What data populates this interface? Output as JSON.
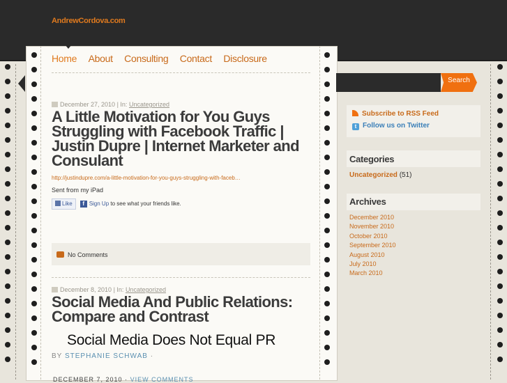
{
  "site": {
    "title": "AndrewCordova.com"
  },
  "nav": {
    "items": [
      {
        "label": "Home",
        "active": true
      },
      {
        "label": "About"
      },
      {
        "label": "Consulting"
      },
      {
        "label": "Contact"
      },
      {
        "label": "Disclosure"
      }
    ]
  },
  "posts": [
    {
      "date": "December 27, 2010",
      "in_label": "| In:",
      "category": "Uncategorized",
      "title": "A Little Motivation for You Guys Struggling with Facebook Traffic | Justin Dupre | Internet Marketer and Consulant",
      "link": "http://justindupre.com/a-little-motivation-for-you-guys-struggling-with-faceb…",
      "text": "Sent from my iPad",
      "like_label": "Like",
      "signup_label": "Sign Up",
      "signup_suffix": " to see what your friends like.",
      "comments": "No Comments"
    },
    {
      "date": "December 8, 2010",
      "in_label": "| In:",
      "category": "Uncategorized",
      "title": "Social Media And Public Relations: Compare and Contrast",
      "headline": "Social Media Does Not Equal PR",
      "by_label": "BY",
      "author": "STEPHANIE SCHWAB",
      "by_sep": " ·",
      "cut_date": "DECEMBER 7, 2010 ·",
      "view_comments": "VIEW COMMENTS"
    }
  ],
  "sidebar": {
    "search_label": "Search",
    "rss_label": "Subscribe to RSS Feed",
    "twitter_label": "Follow us on Twitter",
    "categories": {
      "heading": "Categories",
      "items": [
        {
          "name": "Uncategorized",
          "count": "(51)"
        }
      ]
    },
    "archives": {
      "heading": "Archives",
      "items": [
        "December 2010",
        "November 2010",
        "October 2010",
        "September 2010",
        "August 2010",
        "July 2010",
        "March 2010"
      ]
    }
  },
  "colors": {
    "accent": "#e07a1e",
    "topbar": "#2a2a2a",
    "search": "#f07010"
  }
}
